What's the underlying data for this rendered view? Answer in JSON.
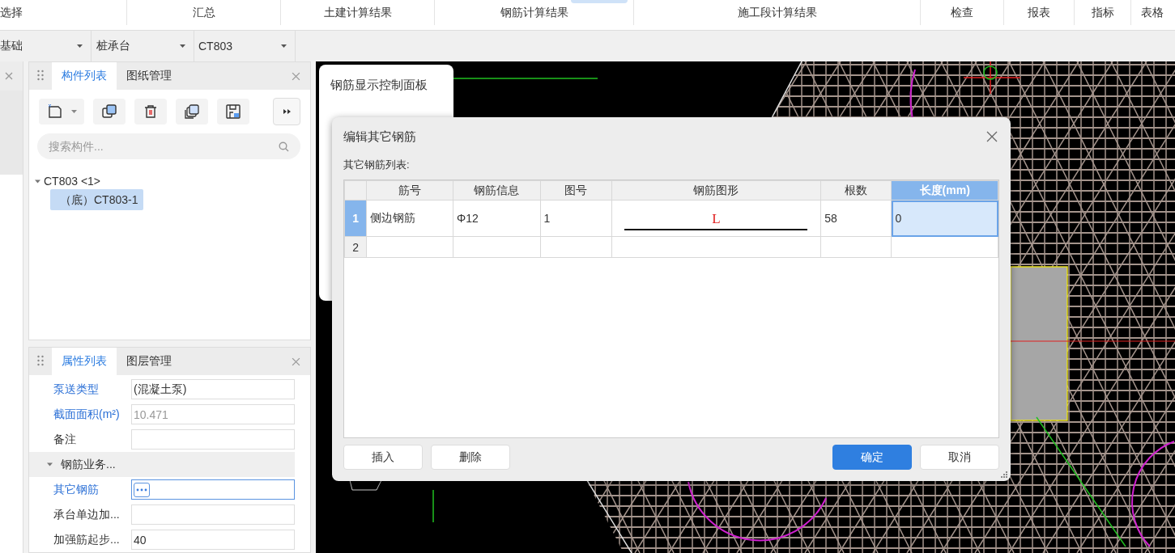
{
  "ribbon": {
    "groups": [
      "选择",
      "汇总",
      "土建计算结果",
      "钢筋计算结果",
      "施工段计算结果",
      "检查",
      "报表",
      "指标",
      "表格"
    ]
  },
  "selectors": [
    {
      "value": "基础"
    },
    {
      "value": "桩承台"
    },
    {
      "value": "CT803"
    }
  ],
  "component_panel": {
    "tabs": [
      {
        "label": "构件列表",
        "selected": true
      },
      {
        "label": "图纸管理",
        "selected": false
      }
    ],
    "search": {
      "placeholder": "搜索构件..."
    },
    "tree": [
      {
        "label": "CT803 <1>",
        "expanded": true,
        "selected": false,
        "children": [
          {
            "label": "（底）CT803-1",
            "selected": true
          }
        ]
      }
    ]
  },
  "property_panel": {
    "tabs": [
      {
        "label": "属性列表",
        "selected": true
      },
      {
        "label": "图层管理",
        "selected": false
      }
    ],
    "rows": [
      {
        "kind": "field",
        "label": "泵送类型",
        "value": "(混凝土泵)",
        "public": true,
        "focused": false
      },
      {
        "kind": "field",
        "label": "截面面积(m²)",
        "value": "10.471",
        "public": true,
        "readonly": true,
        "focused": false
      },
      {
        "kind": "field",
        "label": "备注",
        "public": false,
        "focused": false
      },
      {
        "kind": "group",
        "label": "钢筋业务...",
        "expanded": true
      },
      {
        "kind": "field",
        "label": "其它钢筋",
        "public": true,
        "focused": true
      },
      {
        "kind": "field",
        "label": "承台单边加...",
        "public": false,
        "focused": false
      },
      {
        "kind": "field",
        "label": "加强筋起步...",
        "value": "40",
        "public": false,
        "focused": false
      }
    ]
  },
  "rebar_panel": {
    "title": "钢筋显示控制面板"
  },
  "dialog": {
    "title": "编辑其它钢筋",
    "list_label": "其它钢筋列表:",
    "table": {
      "columns": [
        {
          "label": "筋号",
          "selected": false
        },
        {
          "label": "钢筋信息",
          "selected": false
        },
        {
          "label": "图号",
          "selected": false
        },
        {
          "label": "钢筋图形",
          "selected": false
        },
        {
          "label": "根数",
          "selected": false
        },
        {
          "label": "长度(mm)",
          "selected": true
        }
      ],
      "rows": [
        {
          "number": "1",
          "selected": true,
          "bar_name": "侧边钢筋",
          "bar_info": "Φ12",
          "figure_no": "1",
          "shape": {
            "kind": "straight",
            "label": "L"
          },
          "count": "58",
          "length": "0"
        },
        {
          "number": "2",
          "selected": false
        }
      ]
    },
    "left_buttons": [
      {
        "label": "插入",
        "primary": false
      },
      {
        "label": "删除",
        "primary": false
      }
    ],
    "right_buttons": [
      {
        "label": "确定",
        "primary": true
      },
      {
        "label": "取消",
        "primary": false
      }
    ]
  }
}
